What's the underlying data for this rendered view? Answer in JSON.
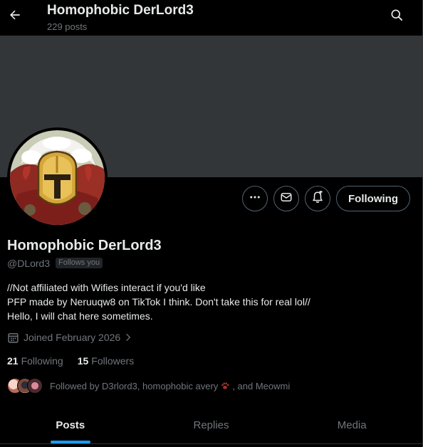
{
  "header": {
    "title": "Homophobic DerLord3",
    "post_count": "229 posts",
    "back_icon": "arrow-left-icon",
    "search_icon": "search-icon"
  },
  "colors": {
    "background": "#000000",
    "banner": "#333639",
    "accent": "#1d9bf0",
    "muted_text": "#71767b",
    "primary_text": "#e7e9ea"
  },
  "actions": {
    "more_icon": "more-icon",
    "message_icon": "envelope-icon",
    "notify_icon": "bell-plus-icon",
    "follow_label": "Following"
  },
  "profile": {
    "display_name": "Homophobic DerLord3",
    "handle": "@DLord3",
    "follows_you": "Follows you",
    "bio_lines": [
      "//Not affiliated with Wifies interact if you'd like",
      "PFP made by Neruuqw8 on TikTok I think. Don't take this for real lol//",
      "Hello, I will chat here sometimes."
    ],
    "joined": "Joined February 2026",
    "following_count": "21",
    "following_label": "Following",
    "followers_count": "15",
    "followers_label": "Followers",
    "followed_by_prefix": "Followed by D3rlord3, homophobic avery",
    "followed_by_suffix": ", and Meowmi"
  },
  "tabs": [
    {
      "label": "Posts",
      "active": true
    },
    {
      "label": "Replies",
      "active": false
    },
    {
      "label": "Media",
      "active": false
    }
  ]
}
